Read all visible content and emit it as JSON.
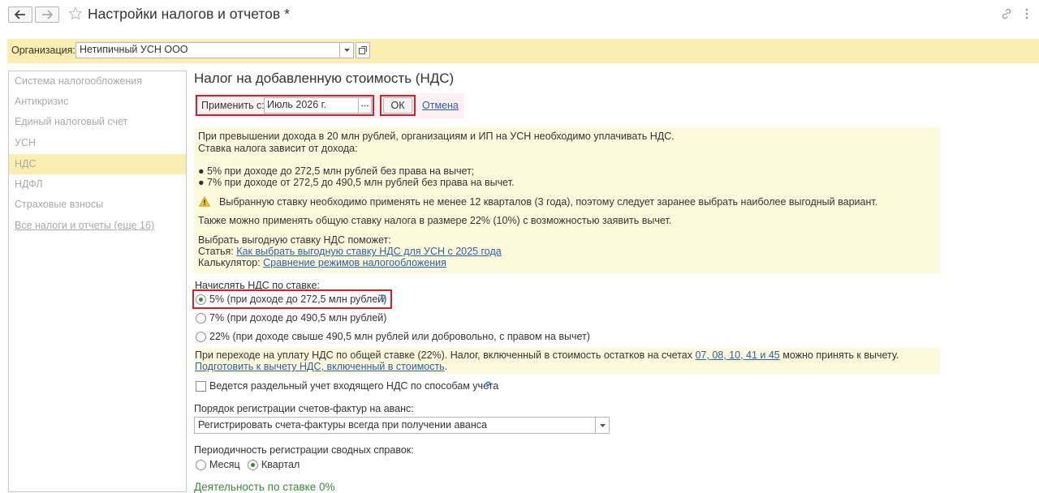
{
  "window": {
    "title": "Настройки налогов и отчетов *"
  },
  "organization": {
    "label": "Организация:",
    "value": "Нетипичный УСН ООО"
  },
  "sidebar": {
    "items": [
      {
        "label": "Система налогообложения"
      },
      {
        "label": "Антикризис"
      },
      {
        "label": "Единый налоговый счет"
      },
      {
        "label": "УСН"
      },
      {
        "label": "НДС"
      },
      {
        "label": "НДФЛ"
      },
      {
        "label": "Страховые взносы"
      },
      {
        "label": "Все налоги и отчеты (еще 16)"
      }
    ]
  },
  "main": {
    "heading": "Налог на добавленную стоимость (НДС)",
    "apply": {
      "label": "Применить с:",
      "value": "Июль 2026 г.",
      "ok_label": "ОК",
      "cancel_label": "Отмена"
    },
    "info": {
      "line1": "При превышении дохода в 20 млн рублей, организациям и ИП на УСН необходимо уплачивать НДС.",
      "line2": "Ставка налога зависит от дохода:",
      "bullet1": "● 5% при доходе до 272,5 млн рублей без права на вычет;",
      "bullet2": "● 7% при доходе от 272,5 до 490,5 млн рублей без права на вычет.",
      "warning": "Выбранную ставку необходимо применять не менее 12 кварталов (3 года), поэтому следует заранее выбрать наиболее выгодный вариант.",
      "general": "Также можно применять общую ставку налога в размере 22% (10%) с возможностью заявить вычет.",
      "help_intro": "Выбрать выгодную ставку НДС поможет:",
      "article_label": "Статья:",
      "article_link": "Как выбрать выгодную ставку НДС для УСН с 2025 года",
      "calc_label": "Калькулятор:",
      "calc_link": "Сравнение режимов налогообложения"
    },
    "rate": {
      "label": "Начислять НДС по ставке:",
      "options": [
        {
          "label": "5% (при доходе до 272,5 млн рублей)"
        },
        {
          "label": "7% (при доходе до 490,5 млн рублей)"
        },
        {
          "label": "22% (при доходе свыше 490,5 млн рублей или добровольно, с правом на вычет)"
        }
      ],
      "selected": 0,
      "help": "?"
    },
    "transition": {
      "text_before": "При переходе на уплату НДС по общей ставке (22%). Налог, включенный в стоимость остатков на счетах",
      "accounts_link": "07, 08, 10, 41 и 45",
      "text_after": "можно принять к вычету.",
      "prepare_link": "Подготовить к вычету НДС, включенный в стоимость",
      "dot": "."
    },
    "separate": {
      "label": "Ведется раздельный учет входящего НДС по способам учета",
      "help": "?"
    },
    "invoice_order": {
      "label": "Порядок регистрации счетов-фактур на аванс:",
      "value": "Регистрировать счета-фактуры всегда при получении аванса"
    },
    "periodicity": {
      "label": "Периодичность регистрации сводных справок:",
      "options": [
        {
          "label": "Месяц"
        },
        {
          "label": "Квартал"
        }
      ],
      "selected": 1
    },
    "zero_rate": {
      "label": "Деятельность по ставке 0%"
    }
  }
}
